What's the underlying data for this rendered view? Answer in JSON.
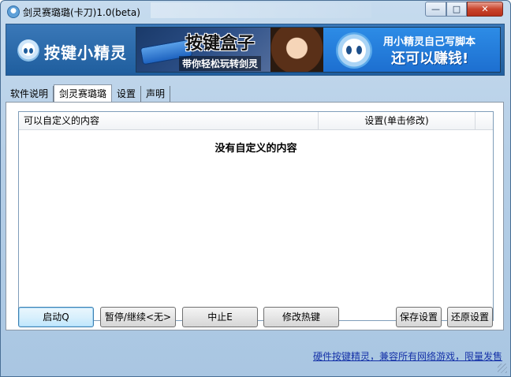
{
  "window": {
    "title": "剑灵赛璐璐(卡刀)1.0(beta)",
    "min_glyph": "—",
    "max_glyph": "□",
    "close_glyph": "✕"
  },
  "banner": {
    "logo_text": "按键小精灵",
    "ad_left_title": "按键盒子",
    "ad_left_sub": "带你轻松玩转剑灵",
    "ad_right_line1": "用小精灵自己写脚本",
    "ad_right_line2": "还可以赚钱!"
  },
  "tabs": [
    {
      "label": "软件说明",
      "active": false
    },
    {
      "label": "剑灵赛璐璐",
      "active": true
    },
    {
      "label": "设置",
      "active": false
    },
    {
      "label": "声明",
      "active": false
    }
  ],
  "list": {
    "col1": "可以自定义的内容",
    "col2": "设置(单击修改)",
    "empty_message": "没有自定义的内容"
  },
  "buttons": {
    "start": "启动Q",
    "pause": "暂停/继续<无>",
    "stop": "中止E",
    "hotkey": "修改热键",
    "save": "保存设置",
    "restore": "还原设置"
  },
  "footer": {
    "link": "硬件按键精灵，兼容所有网络游戏，限量发售"
  },
  "colors": {
    "banner_bg": "#2a6aaa",
    "link": "#1633a8",
    "close_btn": "#c9452d"
  }
}
